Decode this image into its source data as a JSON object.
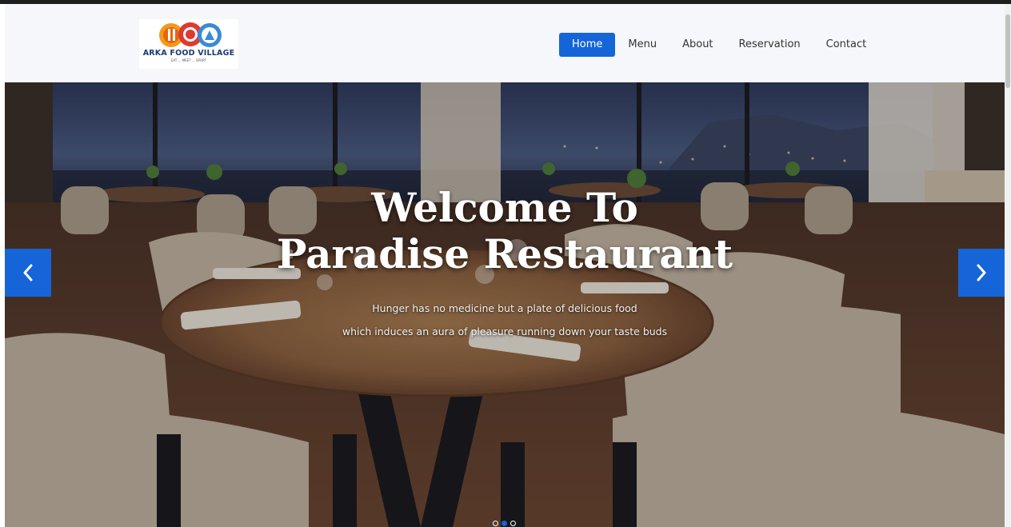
{
  "brand": {
    "name": "ARKA FOOD VILLAGE",
    "tagline": "EAT ... MEET ... SPORT"
  },
  "nav": {
    "items": [
      "Home",
      "Menu",
      "About",
      "Reservation",
      "Contact"
    ],
    "active": "Home"
  },
  "hero": {
    "title_line1": "Welcome To",
    "title_line2": "Paradise Restaurant",
    "subtitle_line1": "Hunger has no medicine but a plate of delicious food",
    "subtitle_line2": "which induces an aura of pleasure running down your taste buds",
    "slides": 3,
    "active_slide": 2,
    "prev_icon": "chevron-left-icon",
    "next_icon": "chevron-right-icon"
  },
  "colors": {
    "accent": "#1565d8",
    "nav_bg": "#f5f7fa"
  }
}
